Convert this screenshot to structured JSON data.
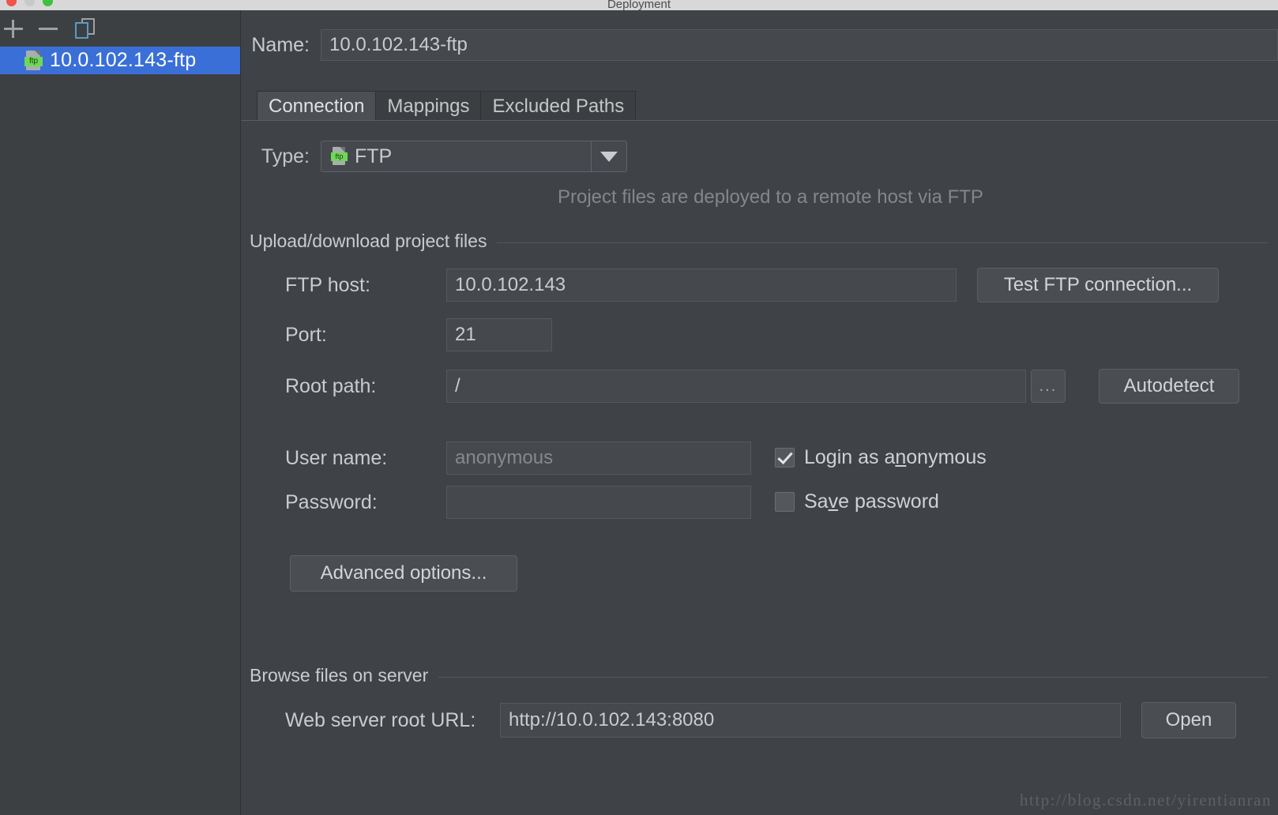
{
  "window": {
    "title": "Deployment",
    "traffic_lights": [
      "close-button",
      "minimize-button",
      "zoom-button"
    ]
  },
  "sidebar": {
    "toolbar": {
      "add_label": "+",
      "remove_label": "−",
      "copy_label": "copy-icon"
    },
    "items": [
      {
        "label": "10.0.102.143-ftp",
        "icon": "ftp-icon",
        "selected": true
      }
    ]
  },
  "form": {
    "name_label": "Name:",
    "name_value": "10.0.102.143-ftp"
  },
  "tabs": [
    {
      "label": "Connection",
      "active": true
    },
    {
      "label": "Mappings",
      "active": false
    },
    {
      "label": "Excluded Paths",
      "active": false
    }
  ],
  "connection": {
    "type_label": "Type:",
    "type_value": "FTP",
    "type_icon": "ftp-icon",
    "type_hint": "Project files are deployed to a remote host via FTP",
    "upload_group_title": "Upload/download project files",
    "ftp_host_label": "FTP host:",
    "ftp_host_value": "10.0.102.143",
    "test_connection_label": "Test FTP connection...",
    "port_label": "Port:",
    "port_value": "21",
    "root_path_label": "Root path:",
    "root_path_value": "/",
    "root_path_browse_label": "...",
    "autodetect_label": "Autodetect",
    "user_name_label": "User name:",
    "user_name_placeholder": "anonymous",
    "user_name_value": "",
    "login_anonymous_label_pre": "Login as a",
    "login_anonymous_mnemonic": "n",
    "login_anonymous_label_post": "onymous",
    "login_anonymous_checked": true,
    "password_label": "Password:",
    "password_value": "",
    "save_password_label_pre": "Sa",
    "save_password_mnemonic": "v",
    "save_password_label_post": "e password",
    "save_password_checked": false,
    "advanced_options_label": "Advanced options...",
    "browse_group_title": "Browse files on server",
    "web_root_label": "Web server root URL:",
    "web_root_value": "http://10.0.102.143:8080",
    "open_label": "Open"
  },
  "watermark": "http://blog.csdn.net/yirentianran",
  "colors": {
    "background": "#3f4347",
    "sidebar": "#3c4043",
    "selection": "#3a6fd8",
    "field": "#45494d",
    "text": "#c9ccce",
    "muted": "#83878a",
    "ftp_badge": "#6ed857"
  }
}
